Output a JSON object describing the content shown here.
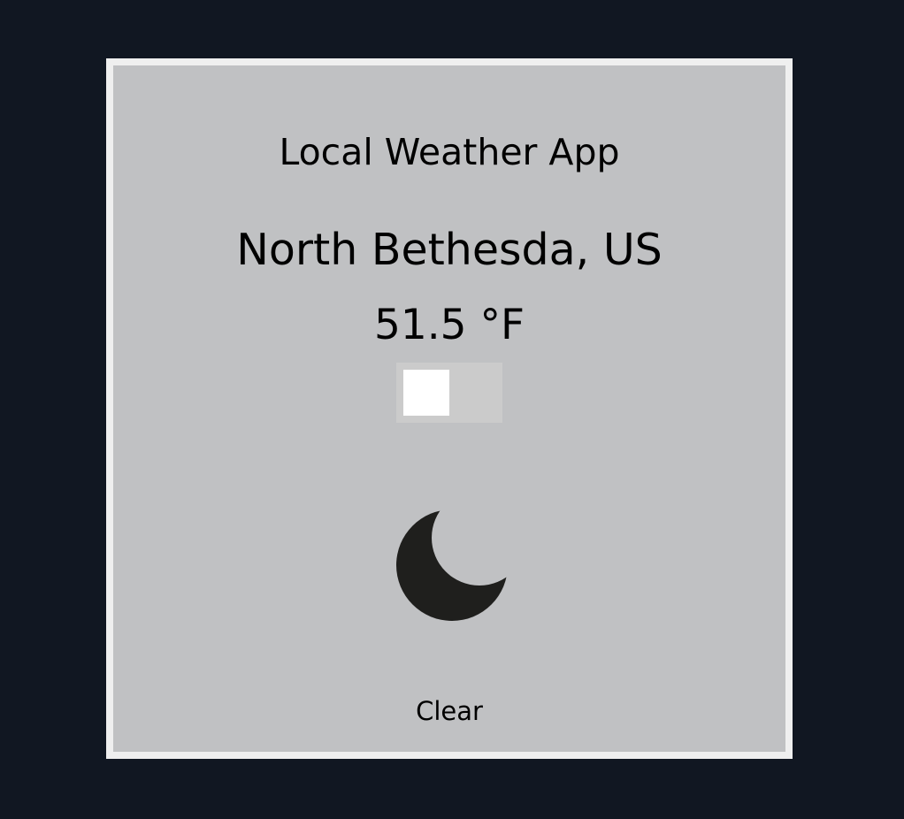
{
  "app": {
    "title": "Local Weather App"
  },
  "weather": {
    "location": "North Bethesda, US",
    "temperature": "51.5 °F",
    "condition": "Clear",
    "icon": "moon-icon"
  },
  "unit_toggle": {
    "state": "off"
  },
  "colors": {
    "background": "#111722",
    "card": "#c0c1c3",
    "card_border": "#efefef",
    "toggle_track": "#cbcbcb",
    "toggle_knob": "#ffffff",
    "icon": "#1f1f1d"
  }
}
